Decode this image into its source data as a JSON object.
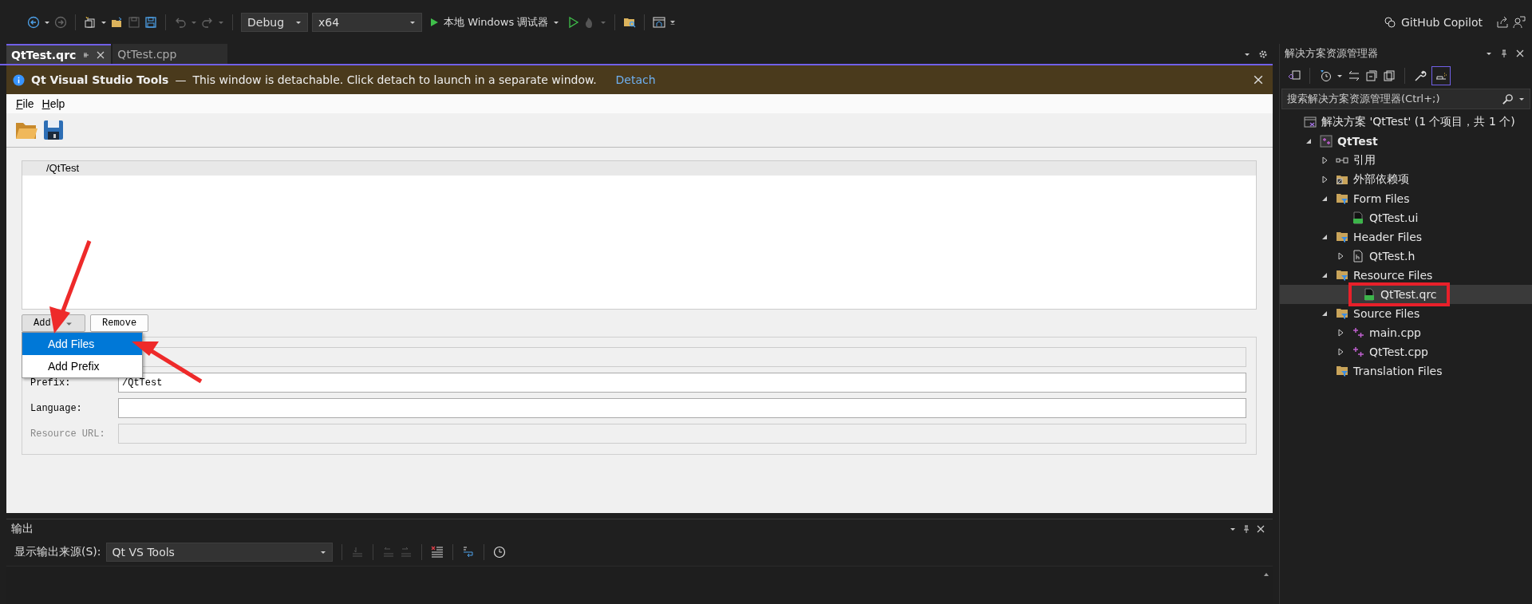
{
  "toolbar": {
    "configuration": "Debug",
    "platform": "x64",
    "debugger": "本地 Windows 调试器",
    "copilot": "GitHub Copilot"
  },
  "tabs": [
    {
      "label": "QtTest.qrc",
      "selected": true
    },
    {
      "label": "QtTest.cpp",
      "selected": false
    }
  ],
  "info_bar": {
    "title": "Qt Visual Studio Tools",
    "dash": "—",
    "message": "This window is detachable. Click detach to launch in a separate window.",
    "link": "Detach"
  },
  "editor": {
    "menu": [
      "File",
      "Help"
    ],
    "resources": [
      {
        "label": "/QtTest",
        "selected": true
      }
    ],
    "add_button": "Add",
    "remove_button": "Remove",
    "add_menu": [
      {
        "label": "Add Files",
        "selected": true
      },
      {
        "label": "Add Prefix",
        "selected": false
      }
    ],
    "fields": [
      {
        "disabled": true
      },
      {
        "label": "Prefix:",
        "value": "/QtTest",
        "disabled": false
      },
      {
        "label": "Language:",
        "disabled": false
      },
      {
        "label": "Resource URL:",
        "disabled": true
      }
    ]
  },
  "output": {
    "title": "输出",
    "source_label": "显示输出来源(S):",
    "source": "Qt VS Tools"
  },
  "solution_explorer": {
    "title": "解决方案资源管理器",
    "search_placeholder": "搜索解决方案资源管理器(Ctrl+;)",
    "tree": [
      {
        "label": "解决方案 'QtTest' (1 个项目，共 1 个)",
        "kind": "solution",
        "selected": false,
        "children": [
          {
            "label": "QtTest",
            "kind": "project",
            "expanded": true,
            "selected": false,
            "children": [
              {
                "label": "引用",
                "kind": "references",
                "expanded": false,
                "selected": false
              },
              {
                "label": "外部依赖项",
                "kind": "external",
                "expanded": false,
                "selected": false
              },
              {
                "label": "Form Files",
                "kind": "folder",
                "expanded": true,
                "selected": false,
                "children": [
                  {
                    "label": "QtTest.ui",
                    "kind": "ui",
                    "selected": false
                  }
                ]
              },
              {
                "label": "Header Files",
                "kind": "folder",
                "expanded": true,
                "selected": false,
                "children": [
                  {
                    "label": "QtTest.h",
                    "kind": "header",
                    "expanded": false,
                    "selected": false
                  }
                ]
              },
              {
                "label": "Resource Files",
                "kind": "folder",
                "expanded": true,
                "selected": false,
                "children": [
                  {
                    "label": "QtTest.qrc",
                    "kind": "qrc",
                    "selected": true,
                    "annotated": true
                  }
                ]
              },
              {
                "label": "Source Files",
                "kind": "folder",
                "expanded": true,
                "selected": false,
                "children": [
                  {
                    "label": "main.cpp",
                    "kind": "cpp",
                    "expanded": false,
                    "selected": false
                  },
                  {
                    "label": "QtTest.cpp",
                    "kind": "cpp",
                    "expanded": false,
                    "selected": false
                  }
                ]
              },
              {
                "label": "Translation Files",
                "kind": "folder",
                "selected": false
              }
            ]
          }
        ]
      }
    ]
  }
}
